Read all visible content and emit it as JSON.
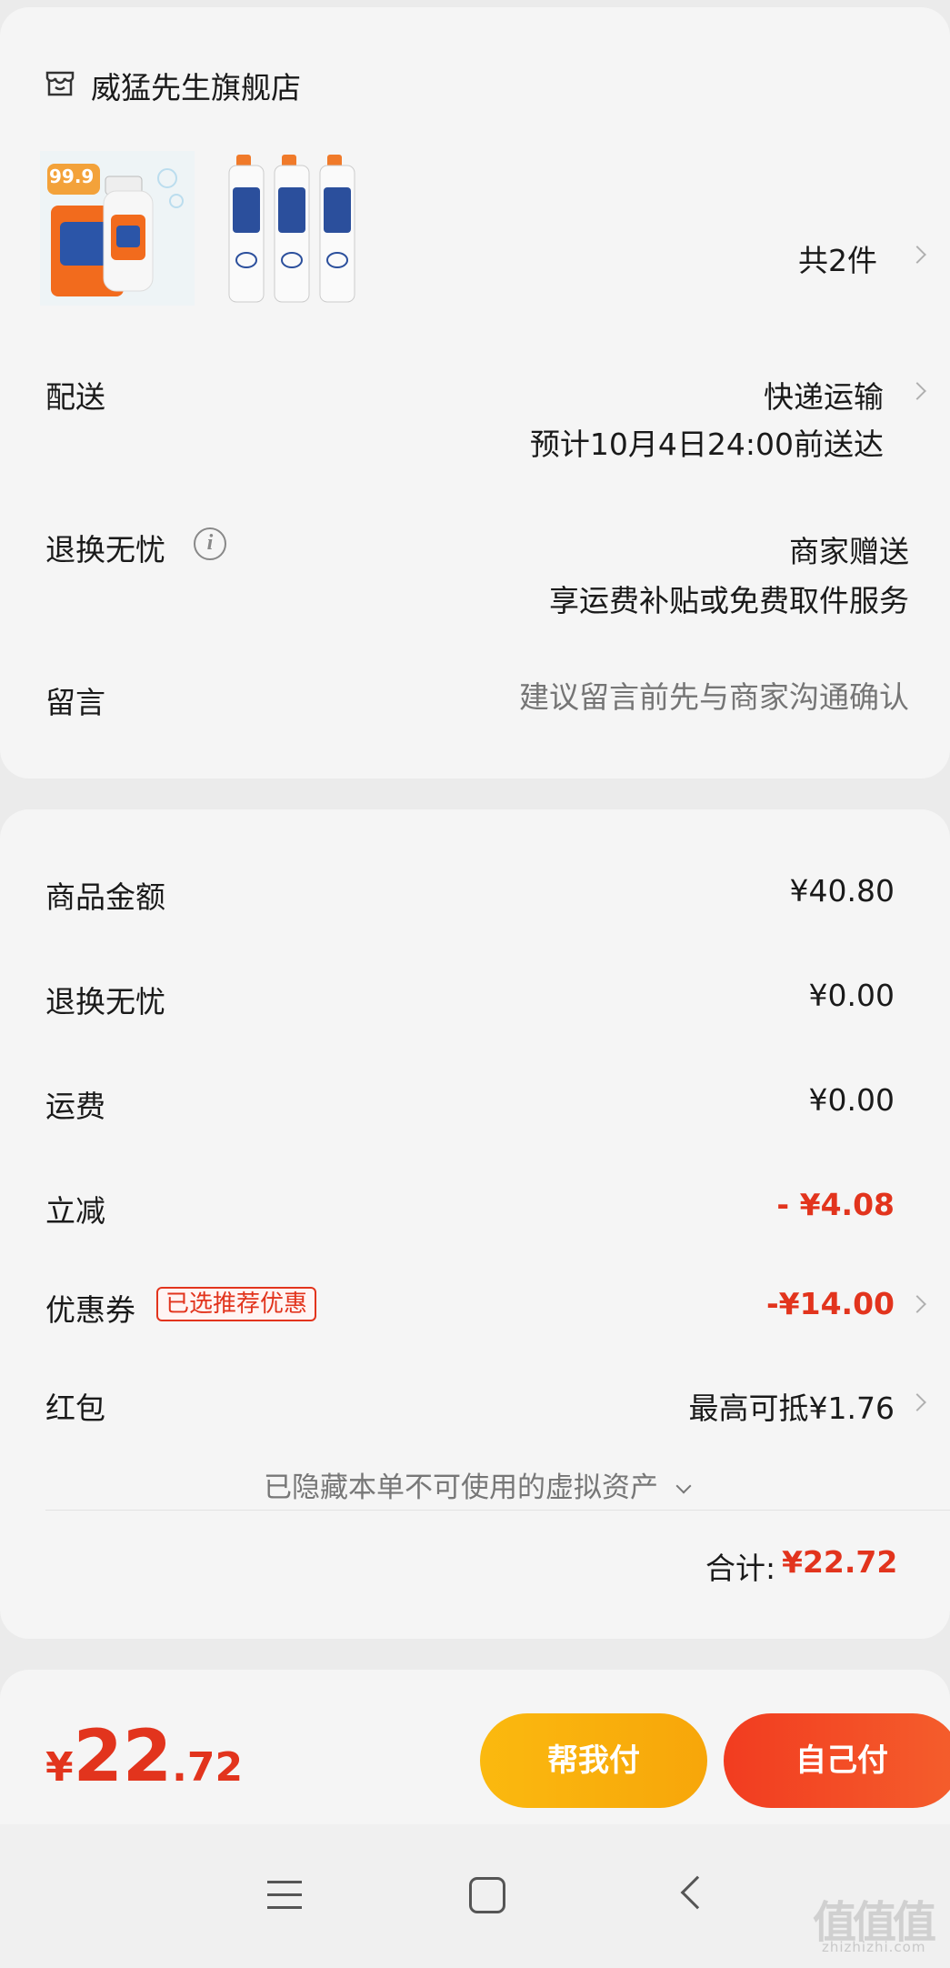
{
  "shop": {
    "name": "威猛先生旗舰店",
    "product1_tag": "99.9",
    "item_count": "共2件"
  },
  "delivery": {
    "label": "配送",
    "method": "快递运输",
    "estimate": "预计10月4日24:00前送达"
  },
  "returns": {
    "label": "退换无忧",
    "value": "商家赠送",
    "desc": "享运费补贴或免费取件服务"
  },
  "message": {
    "label": "留言",
    "placeholder": "建议留言前先与商家沟通确认"
  },
  "price": {
    "goods_label": "商品金额",
    "goods_value": "¥40.80",
    "returns_label": "退换无忧",
    "returns_value": "¥0.00",
    "shipping_label": "运费",
    "shipping_value": "¥0.00",
    "discount_label": "立减",
    "discount_value": "- ¥4.08",
    "coupon_label": "优惠券",
    "coupon_badge": "已选推荐优惠",
    "coupon_value": "-¥14.00",
    "redpacket_label": "红包",
    "redpacket_value": "最高可抵¥1.76",
    "hidden_assets": "已隐藏本单不可使用的虚拟资产",
    "total_label": "合计:",
    "total_value": "¥22.72"
  },
  "bottom": {
    "currency": "¥",
    "amount_int": "22",
    "amount_dec": ".72",
    "help_pay": "帮我付",
    "self_pay": "自己付"
  },
  "watermark": {
    "logo": "值值值",
    "url": "zhizhizhi.com"
  },
  "colors": {
    "accent_red": "#e2341d",
    "help_pay_bg": "#fbb90f",
    "self_pay_bg": "#f23c20"
  }
}
